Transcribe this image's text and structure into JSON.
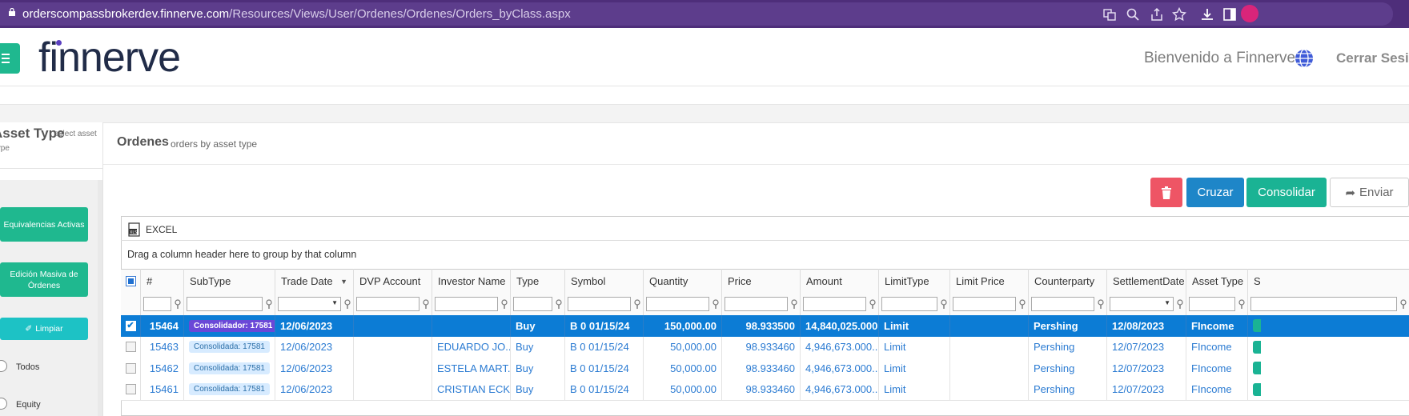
{
  "browser": {
    "url_host": "orderscompassbrokerdev.finnerve.com",
    "url_path": "/Resources/Views/User/Ordenes/Ordenes/Orders_byClass.aspx"
  },
  "header": {
    "logo": "finnerve",
    "welcome": "Bienvenido a Finnerve",
    "logout": "Cerrar Sesión"
  },
  "sidebar": {
    "title": "Asset Type",
    "subtitle": "select asset",
    "subtitle2": "type",
    "buttons": [
      "Equivalencias Activas",
      "Edición Masiva de Órdenes",
      "Limpiar"
    ],
    "radios": [
      "Todos",
      "Equity"
    ]
  },
  "main": {
    "title": "Ordenes",
    "subtitle": "orders by asset type",
    "actions": {
      "delete": "trash-icon",
      "cruzar": "Cruzar",
      "consolidar": "Consolidar",
      "enviar": "Enviar"
    }
  },
  "grid": {
    "excel": "EXCEL",
    "group_hint": "Drag a column header here to group by that column",
    "columns": [
      "#",
      "SubType",
      "Trade Date",
      "DVP Account",
      "Investor Name",
      "Type",
      "Symbol",
      "Quantity",
      "Price",
      "Amount",
      "LimitType",
      "Limit Price",
      "Counterparty",
      "SettlementDate",
      "Asset Type",
      "S"
    ],
    "rows": [
      {
        "selected": true,
        "id": "15464",
        "subtype": "Consolidador: 17581",
        "trade_date": "12/06/2023",
        "dvp": "",
        "investor": "",
        "type": "Buy",
        "symbol": "B 0 01/15/24",
        "quantity": "150,000.00",
        "price": "98.933500",
        "amount": "14,840,025.000...",
        "limit_type": "Limit",
        "limit_price": "",
        "counterparty": "Pershing",
        "settlement": "12/08/2023",
        "asset_type": "FIncome"
      },
      {
        "selected": false,
        "id": "15463",
        "subtype": "Consolidada: 17581",
        "trade_date": "12/06/2023",
        "dvp": "",
        "investor": "EDUARDO JO...",
        "type": "Buy",
        "symbol": "B 0 01/15/24",
        "quantity": "50,000.00",
        "price": "98.933460",
        "amount": "4,946,673.000...",
        "limit_type": "Limit",
        "limit_price": "",
        "counterparty": "Pershing",
        "settlement": "12/07/2023",
        "asset_type": "FIncome"
      },
      {
        "selected": false,
        "id": "15462",
        "subtype": "Consolidada: 17581",
        "trade_date": "12/06/2023",
        "dvp": "",
        "investor": "ESTELA MART...",
        "type": "Buy",
        "symbol": "B 0 01/15/24",
        "quantity": "50,000.00",
        "price": "98.933460",
        "amount": "4,946,673.000...",
        "limit_type": "Limit",
        "limit_price": "",
        "counterparty": "Pershing",
        "settlement": "12/07/2023",
        "asset_type": "FIncome"
      },
      {
        "selected": false,
        "id": "15461",
        "subtype": "Consolidada: 17581",
        "trade_date": "12/06/2023",
        "dvp": "",
        "investor": "CRISTIAN ECK...",
        "type": "Buy",
        "symbol": "B 0 01/15/24",
        "quantity": "50,000.00",
        "price": "98.933460",
        "amount": "4,946,673.000...",
        "limit_type": "Limit",
        "limit_price": "",
        "counterparty": "Pershing",
        "settlement": "12/07/2023",
        "asset_type": "FIncome"
      }
    ]
  },
  "colors": {
    "browser": "#4e2e7a",
    "accent_green": "#1fb88f",
    "selected_row": "#0c7cd5",
    "link": "#2b7bd2",
    "delete": "#ee5565",
    "cruzar": "#1e86c8"
  }
}
